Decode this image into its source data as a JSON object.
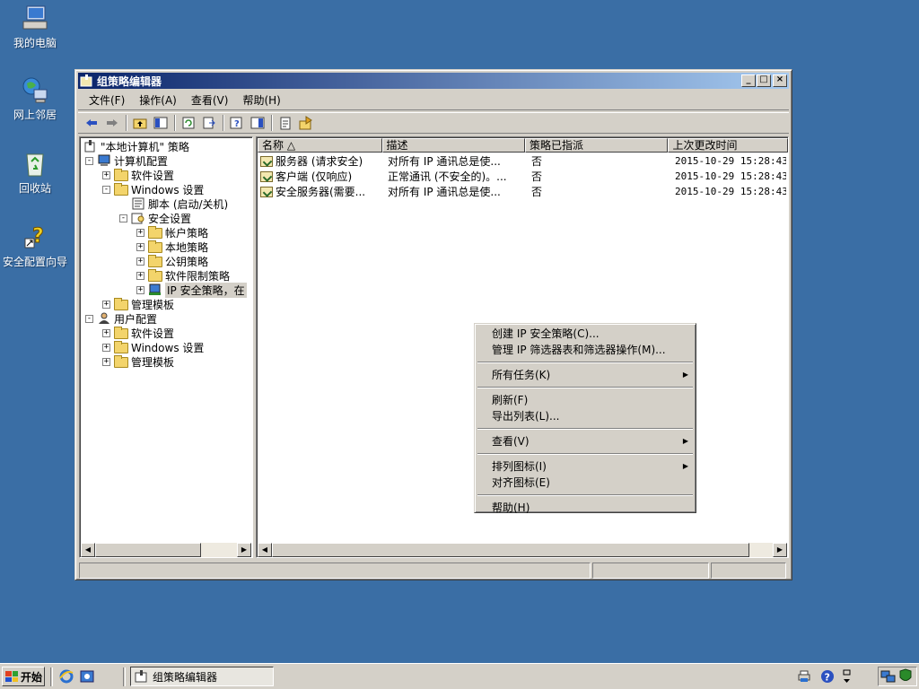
{
  "desktop": {
    "icons": [
      {
        "label": "我的电脑",
        "icon": "my-computer-icon"
      },
      {
        "label": "网上邻居",
        "icon": "network-neighborhood-icon"
      },
      {
        "label": "回收站",
        "icon": "recycle-bin-icon"
      },
      {
        "label": "安全配置向导",
        "icon": "security-config-wizard-icon"
      }
    ]
  },
  "window": {
    "title": "组策略编辑器",
    "menu": [
      "文件(F)",
      "操作(A)",
      "查看(V)",
      "帮助(H)"
    ],
    "tree": [
      {
        "label": "\"本地计算机\" 策略"
      },
      {
        "label": "计算机配置",
        "exp": "-"
      },
      {
        "label": "软件设置",
        "exp": "+"
      },
      {
        "label": "Windows 设置",
        "exp": "-"
      },
      {
        "label": "脚本 (启动/关机)"
      },
      {
        "label": "安全设置",
        "exp": "-"
      },
      {
        "label": "帐户策略",
        "exp": "+"
      },
      {
        "label": "本地策略",
        "exp": "+"
      },
      {
        "label": "公钥策略",
        "exp": "+"
      },
      {
        "label": "软件限制策略",
        "exp": "+"
      },
      {
        "label": "IP 安全策略，在",
        "exp": "+"
      },
      {
        "label": "管理模板",
        "exp": "+"
      },
      {
        "label": "用户配置",
        "exp": "-"
      },
      {
        "label": "软件设置",
        "exp": "+"
      },
      {
        "label": "Windows 设置",
        "exp": "+"
      },
      {
        "label": "管理模板",
        "exp": "+"
      }
    ],
    "list": {
      "columns": [
        "名称 △",
        "描述",
        "策略已指派",
        "上次更改时间"
      ],
      "rows": [
        [
          "服务器 (请求安全)",
          "对所有 IP 通讯总是使...",
          "否",
          "2015-10-29 15:28:43"
        ],
        [
          "客户端 (仅响应)",
          "正常通讯 (不安全的)。...",
          "否",
          "2015-10-29 15:28:43"
        ],
        [
          "安全服务器(需要...",
          "对所有 IP 通讯总是使...",
          "否",
          "2015-10-29 15:28:43"
        ]
      ]
    }
  },
  "context_menu": {
    "create_policy": "创建 IP 安全策略(C)...",
    "manage_filters": "管理 IP 筛选器表和筛选器操作(M)...",
    "all_tasks": "所有任务(K)",
    "refresh": "刷新(F)",
    "export_list": "导出列表(L)...",
    "view": "查看(V)",
    "arrange_icons": "排列图标(I)",
    "line_up_icons": "对齐图标(E)",
    "help": "帮助(H)"
  },
  "taskbar": {
    "start_label": "开始",
    "task_label": "组策略编辑器"
  }
}
